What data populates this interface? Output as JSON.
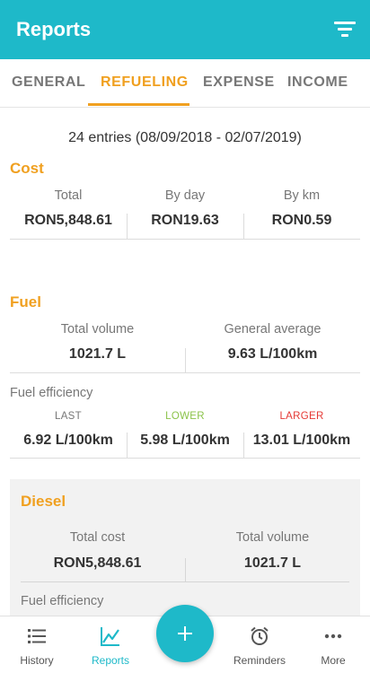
{
  "appbar": {
    "title": "Reports",
    "filter_icon": "filter-icon"
  },
  "tabs": [
    {
      "label": "GENERAL",
      "active": false
    },
    {
      "label": "REFUELING",
      "active": true
    },
    {
      "label": "EXPENSE",
      "active": false
    },
    {
      "label": "INCOME",
      "active": false
    }
  ],
  "summary": "24 entries (08/09/2018 - 02/07/2019)",
  "cost": {
    "title": "Cost",
    "stats": [
      {
        "label": "Total",
        "value": "RON5,848.61"
      },
      {
        "label": "By day",
        "value": "RON19.63"
      },
      {
        "label": "By km",
        "value": "RON0.59"
      }
    ]
  },
  "fuel": {
    "title": "Fuel",
    "stats": [
      {
        "label": "Total volume",
        "value": "1021.7 L"
      },
      {
        "label": "General average",
        "value": "9.63 L/100km"
      }
    ],
    "efficiency_label": "Fuel efficiency",
    "efficiency": [
      {
        "label": "LAST",
        "value": "6.92 L/100km",
        "color": "#777777"
      },
      {
        "label": "LOWER",
        "value": "5.98 L/100km",
        "color": "#8bc34a"
      },
      {
        "label": "LARGER",
        "value": "13.01 L/100km",
        "color": "#e53935"
      }
    ]
  },
  "diesel": {
    "title": "Diesel",
    "stats": [
      {
        "label": "Total cost",
        "value": "RON5,848.61"
      },
      {
        "label": "Total volume",
        "value": "1021.7 L"
      }
    ],
    "efficiency_label": "Fuel efficiency"
  },
  "bottom_nav": [
    {
      "label": "History",
      "icon": "list-icon",
      "active": false
    },
    {
      "label": "Reports",
      "icon": "chart-icon",
      "active": true
    },
    {
      "label": "Reminders",
      "icon": "alarm-clock-icon",
      "active": false
    },
    {
      "label": "More",
      "icon": "more-dots-icon",
      "active": false
    }
  ],
  "fab": {
    "icon": "plus-icon"
  },
  "colors": {
    "primary": "#1eb9c9",
    "accent": "#f0a020",
    "lower": "#8bc34a",
    "larger": "#e53935"
  }
}
